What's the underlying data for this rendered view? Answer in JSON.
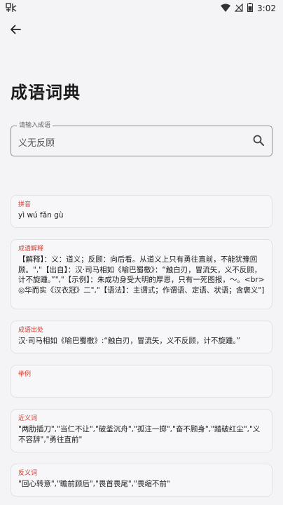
{
  "status_bar": {
    "time": "3:02",
    "app_icon": "app-logo-icon"
  },
  "header": {
    "back_icon": "arrow-left-icon"
  },
  "page": {
    "title": "成语词典"
  },
  "search": {
    "label": "请输入成语",
    "value": "义无反顾",
    "icon": "search-icon"
  },
  "sections": [
    {
      "title": "拼音",
      "body": "yì wú fǎn gù"
    },
    {
      "title": "成语解释",
      "body": "【解释】：义：道义；反顾：向后看。从道义上只有勇往直前，不能犹豫回顾。\",\"【出自】：汉·司马相如《喻巴蜀檄》：“触白刃，冒流矢，义不反顾，计不旋踵。”\",\"【示例】：朱成功身受大明的厚恩，只有一死图报，～。<br>◎华而实《汉衣冠》二\",\"【语法】：主谓式；作谓语、定语、状语；含褒义\"]"
    },
    {
      "title": "成语出处",
      "body": "汉·司马相如《喻巴蜀檄》:“触白刃，冒流矢，义不反顾，计不旋踵。”"
    },
    {
      "title": "举例",
      "body": ""
    },
    {
      "title": "近义词",
      "body": "\"两肋插刀\",\"当仁不让\",\"破釜沉舟\",\"孤注一掷\",\"奋不顾身\",\"踏破红尘\",\"义不容辞\",\"勇往直前\""
    },
    {
      "title": "反义词",
      "body": "\"回心转意\",\"瞻前顾后\",\"畏首畏尾\",\"畏缩不前\""
    }
  ],
  "colors": {
    "background": "#f4f4f6",
    "section_title": "#d23b2f",
    "card": "#f7f7f9"
  }
}
